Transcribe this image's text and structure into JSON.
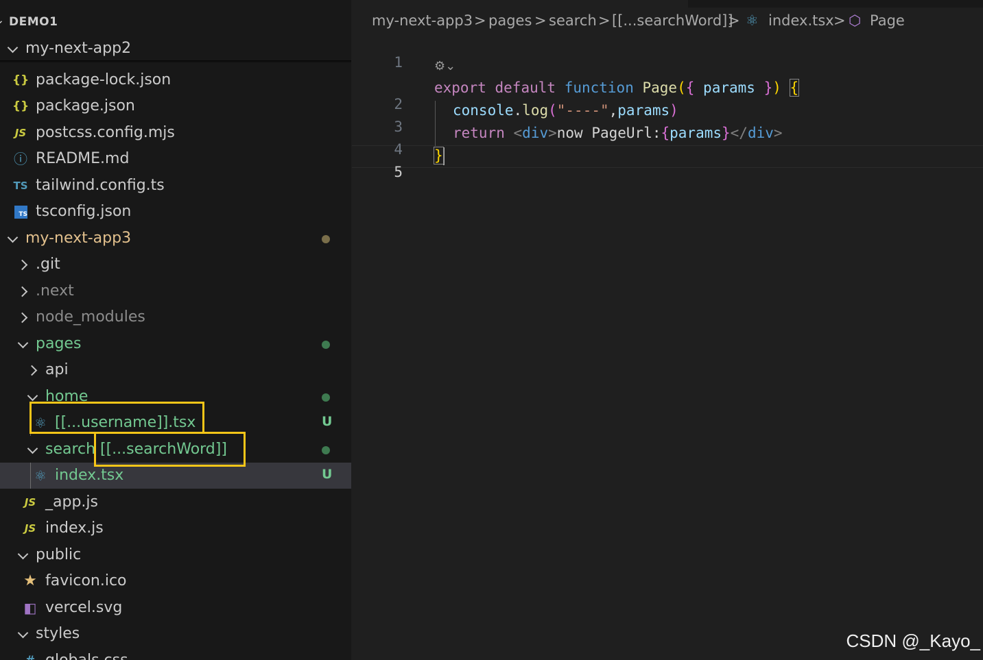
{
  "explorer": {
    "workspace_title": "DEMO1",
    "sticky_folder": "my-next-app2",
    "rows": [
      {
        "label": "package-lock.json",
        "icon": "{}",
        "icon_name": "json-icon"
      },
      {
        "label": "package.json",
        "icon": "{}",
        "icon_name": "json-icon"
      },
      {
        "label": "postcss.config.mjs",
        "icon": "JS",
        "icon_name": "javascript-icon"
      },
      {
        "label": "README.md",
        "icon": "ⓘ",
        "icon_name": "info-icon"
      },
      {
        "label": "tailwind.config.ts",
        "icon": "TS",
        "icon_name": "typescript-icon"
      },
      {
        "label": "tsconfig.json",
        "icon": "TS",
        "icon_name": "tsconfig-icon"
      },
      {
        "label": "my-next-app3",
        "icon_name": "folder",
        "status": "modified"
      },
      {
        "label": ".git"
      },
      {
        "label": ".next"
      },
      {
        "label": "node_modules"
      },
      {
        "label": "pages",
        "status": "untracked"
      },
      {
        "label": "api"
      },
      {
        "label": "home",
        "status": "untracked"
      },
      {
        "label": "[[...username]].tsx",
        "icon": "⚛",
        "icon_name": "react-icon",
        "status_letter": "U"
      },
      {
        "label": "search",
        "status": "untracked",
        "suffix": "[[...searchWord]]"
      },
      {
        "label": "index.tsx",
        "icon": "⚛",
        "icon_name": "react-icon",
        "status_letter": "U"
      },
      {
        "label": "_app.js",
        "icon": "JS",
        "icon_name": "javascript-icon"
      },
      {
        "label": "index.js",
        "icon": "JS",
        "icon_name": "javascript-icon"
      },
      {
        "label": "public"
      },
      {
        "label": "favicon.ico",
        "icon": "★",
        "icon_name": "star-icon"
      },
      {
        "label": "vercel.svg",
        "icon": "◧",
        "icon_name": "svg-file-icon"
      },
      {
        "label": "styles"
      },
      {
        "label": "globals.css",
        "icon": "#",
        "icon_name": "css-icon"
      }
    ]
  },
  "breadcrumb": {
    "items": [
      "my-next-app3",
      "pages",
      "search",
      "[[...searchWord]]",
      "index.tsx",
      "Page"
    ],
    "sep": ">"
  },
  "editor": {
    "line_numbers": [
      "1",
      "2",
      "3",
      "4",
      "5"
    ],
    "codelens": "⚙⌄",
    "tokens": {
      "export": "export",
      "default": "default",
      "function": "function",
      "fn_name": "Page",
      "paren_open": "(",
      "brace_open": "{",
      "param": "params",
      "brace_close": "}",
      "paren_close": ")",
      "body_open": "{",
      "console": "console",
      "dot": ".",
      "log": "log",
      "log_paren_open": "(",
      "string": "\"----\"",
      "comma": ",",
      "log_param": "params",
      "log_paren_close": ")",
      "return": "return",
      "tag_open_lt": "<",
      "div": "div",
      "tag_open_gt": ">",
      "text": "now PageUrl:",
      "expr_open": "{",
      "expr_param": "params",
      "expr_close": "}",
      "close_lt": "</",
      "close_div": "div",
      "close_gt": ">",
      "body_close": "}"
    }
  },
  "watermark": "CSDN @_Kayo_",
  "colors": {
    "sidebar_bg": "#181818",
    "editor_bg": "#1f1f1f",
    "highlight_box": "#f5c518",
    "untracked_green": "#73c991",
    "modified_dot": "#7a6e4a"
  }
}
